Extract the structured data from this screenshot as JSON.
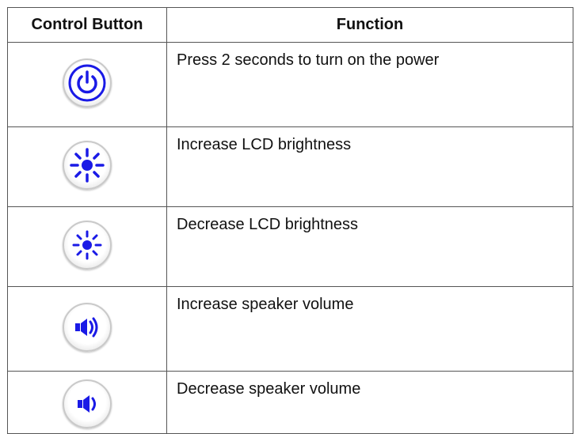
{
  "table": {
    "header": {
      "col1": "Control Button",
      "col2": "Function"
    },
    "rows": [
      {
        "icon": "power-icon",
        "function": "Press 2 seconds to turn on the power"
      },
      {
        "icon": "brightness-up-icon",
        "function": "Increase LCD brightness"
      },
      {
        "icon": "brightness-down-icon",
        "function": "Decrease LCD brightness"
      },
      {
        "icon": "volume-up-icon",
        "function": "Increase speaker volume"
      },
      {
        "icon": "volume-down-icon",
        "function": "Decrease speaker volume"
      }
    ]
  },
  "colors": {
    "icon_blue": "#1a1ae6",
    "border": "#555555"
  }
}
